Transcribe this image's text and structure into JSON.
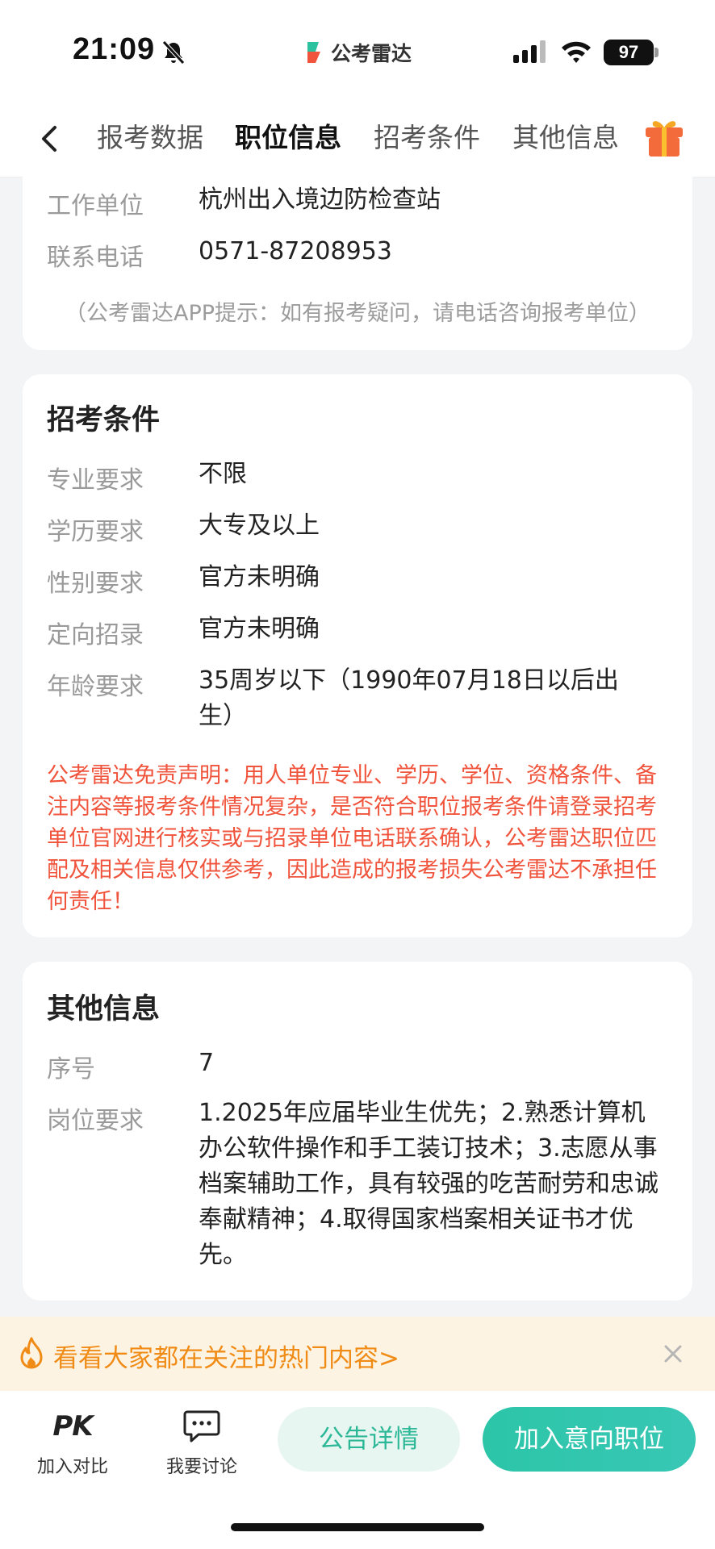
{
  "status_bar": {
    "time": "21:09",
    "battery": "97",
    "app_name": "公考雷达",
    "icons": [
      "mute-icon",
      "signal-icon",
      "wifi-icon",
      "battery-icon"
    ]
  },
  "nav": {
    "tabs": [
      {
        "label": "报考数据",
        "active": false
      },
      {
        "label": "职位信息",
        "active": true
      },
      {
        "label": "招考条件",
        "active": false
      },
      {
        "label": "其他信息",
        "active": false
      }
    ],
    "accent_color": "#2cc2a0"
  },
  "contact_card": {
    "rows": [
      {
        "label": "工作单位",
        "value": "杭州出入境边防检查站"
      },
      {
        "label": "联系电话",
        "value": "0571-87208953"
      }
    ],
    "tip": "（公考雷达APP提示：如有报考疑问，请电话咨询报考单位）"
  },
  "conditions_card": {
    "title": "招考条件",
    "rows": [
      {
        "label": "专业要求",
        "value": "不限"
      },
      {
        "label": "学历要求",
        "value": "大专及以上"
      },
      {
        "label": "性别要求",
        "value": "官方未明确"
      },
      {
        "label": "定向招录",
        "value": "官方未明确"
      },
      {
        "label": "年龄要求",
        "value": "35周岁以下（1990年07月18日以后出生）"
      }
    ],
    "disclaimer": "公考雷达免责声明：用人单位专业、学历、学位、资格条件、备注内容等报考条件情况复杂，是否符合职位报考条件请登录招考单位官网进行核实或与招录单位电话联系确认，公考雷达职位匹配及相关信息仅供参考，因此造成的报考损失公考雷达不承担任何责任！",
    "disclaimer_color": "#f0543c"
  },
  "other_card": {
    "title": "其他信息",
    "rows": [
      {
        "label": "序号",
        "value": "7"
      },
      {
        "label": "岗位要求",
        "value": "1.2025年应届毕业生优先；2.熟悉计算机办公软件操作和手工装订技术；3.志愿从事档案辅助工作，具有较强的吃苦耐劳和忠诚奉献精神；4.取得国家档案相关证书才优先。"
      }
    ]
  },
  "hot_banner": {
    "text": "看看大家都在关注的热门内容>",
    "color": "#f08c16"
  },
  "bottom_bar": {
    "compare_icon_text": "PK",
    "compare_label": "加入对比",
    "discuss_label": "我要讨论",
    "detail_button": "公告详情",
    "join_button": "加入意向职位"
  }
}
